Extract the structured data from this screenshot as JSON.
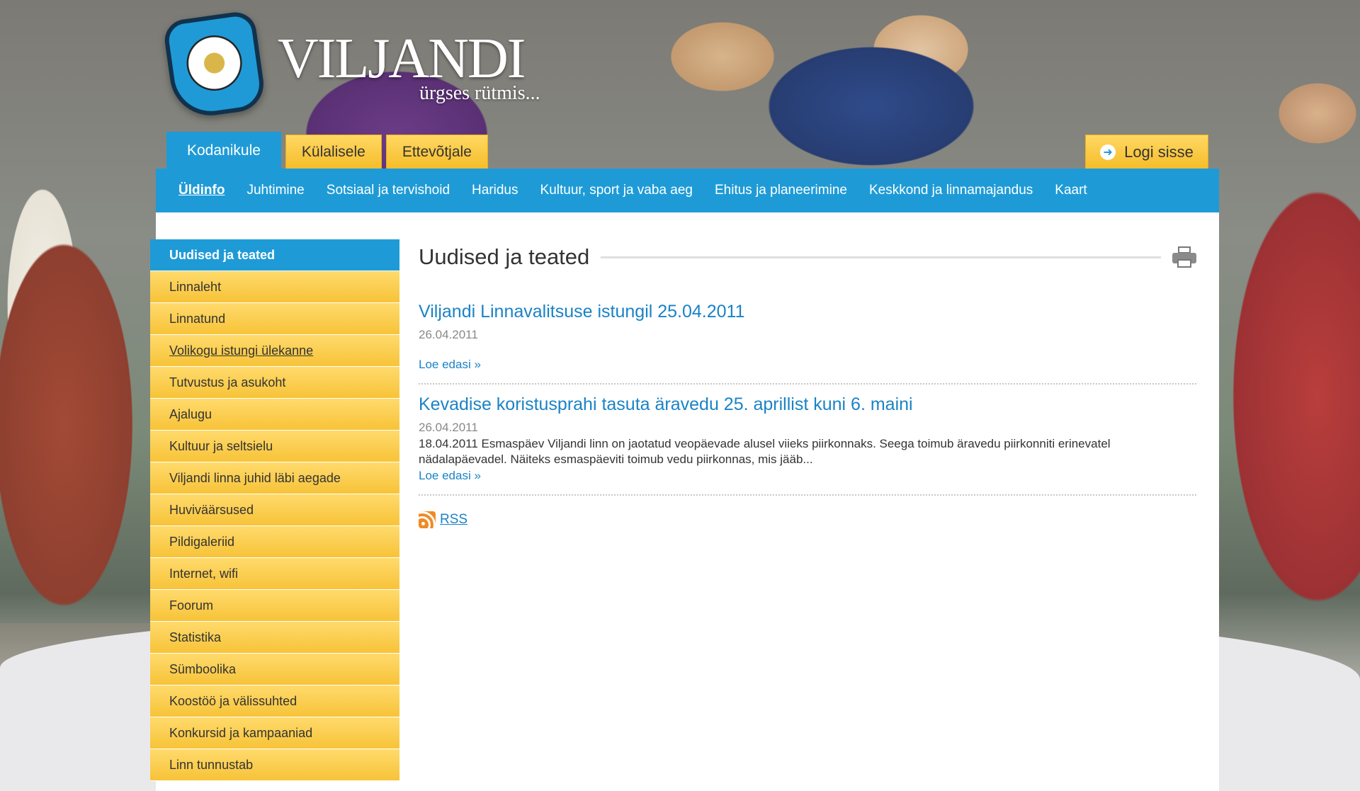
{
  "brand": {
    "title": "VILJANDI",
    "slogan": "ürgses rütmis..."
  },
  "audience_tabs": [
    {
      "label": "Kodanikule",
      "active": true
    },
    {
      "label": "Külalisele",
      "active": false
    },
    {
      "label": "Ettevõtjale",
      "active": false
    }
  ],
  "login": {
    "label": "Logi sisse",
    "icon": "arrow-right-icon"
  },
  "nav": [
    {
      "label": "Üldinfo",
      "active": true
    },
    {
      "label": "Juhtimine"
    },
    {
      "label": "Sotsiaal ja tervishoid"
    },
    {
      "label": "Haridus"
    },
    {
      "label": "Kultuur, sport ja vaba aeg"
    },
    {
      "label": "Ehitus ja planeerimine"
    },
    {
      "label": "Keskkond ja linnamajandus"
    },
    {
      "label": "Kaart"
    }
  ],
  "sidebar": [
    {
      "label": "Uudised ja teated",
      "active": true
    },
    {
      "label": "Linnaleht"
    },
    {
      "label": "Linnatund"
    },
    {
      "label": "Volikogu istungi ülekanne",
      "underline": true
    },
    {
      "label": "Tutvustus ja asukoht"
    },
    {
      "label": "Ajalugu"
    },
    {
      "label": "Kultuur ja seltsielu"
    },
    {
      "label": "Viljandi linna juhid läbi aegade"
    },
    {
      "label": "Huviväärsused"
    },
    {
      "label": "Pildigaleriid"
    },
    {
      "label": "Internet, wifi"
    },
    {
      "label": "Foorum"
    },
    {
      "label": "Statistika"
    },
    {
      "label": "Sümboolika"
    },
    {
      "label": "Koostöö ja välissuhted"
    },
    {
      "label": "Konkursid ja kampaaniad"
    },
    {
      "label": "Linn tunnustab"
    }
  ],
  "main": {
    "title": "Uudised ja teated",
    "news": [
      {
        "title": "Viljandi Linnavalitsuse istungil 25.04.2011",
        "date": "26.04.2011",
        "summary": "",
        "read_more": "Loe edasi »"
      },
      {
        "title": "Kevadise koristusprahi tasuta äravedu 25. aprillist kuni 6. maini",
        "date": "26.04.2011",
        "summary": "18.04.2011 Esmaspäev Viljandi linn on jaotatud veopäevade alusel viieks piirkonnaks. Seega toimub äravedu piirkonniti erinevatel nädalapäevadel. Näiteks esmaspäeviti toimub vedu piirkonnas, mis jääb...",
        "read_more": "Loe edasi »"
      }
    ],
    "rss_label": "RSS"
  },
  "colors": {
    "blue": "#1e9bd7",
    "yellow": "#f7c338",
    "link": "#1a83c6"
  }
}
